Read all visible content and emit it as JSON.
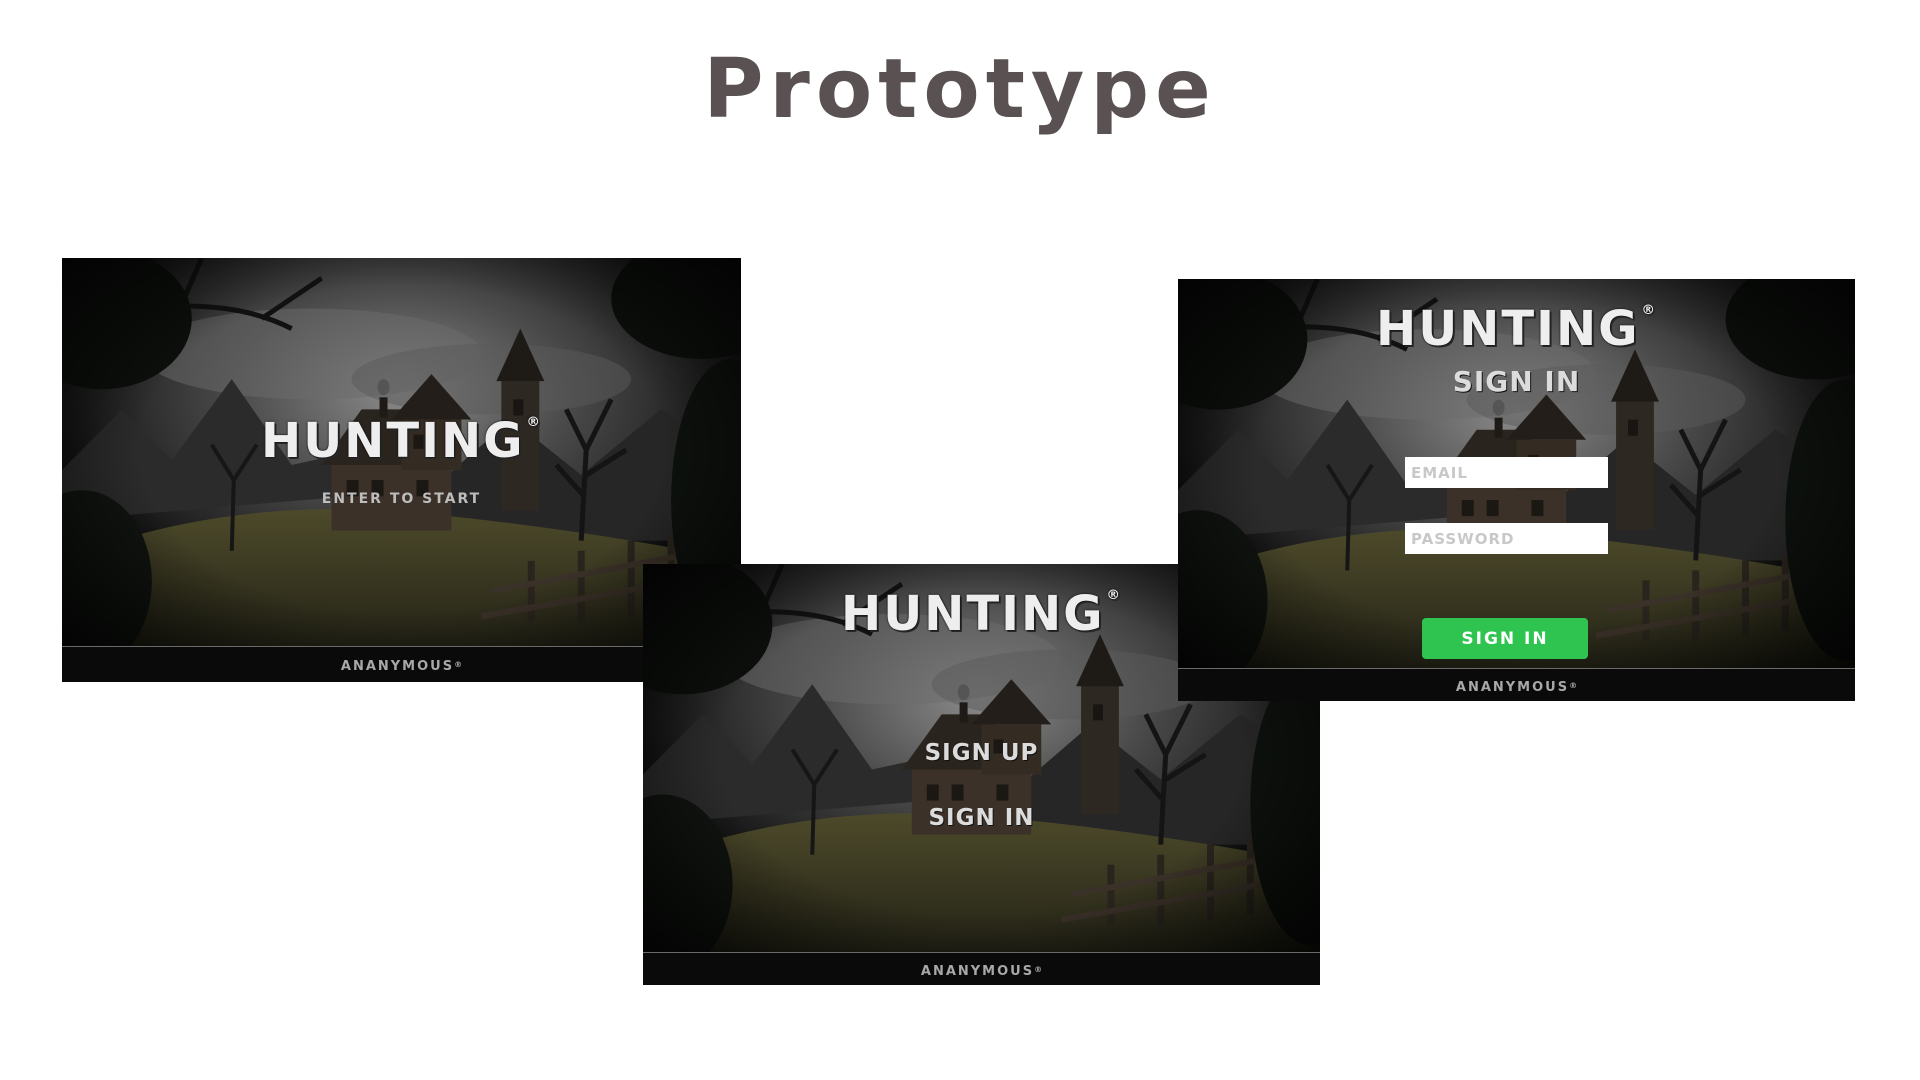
{
  "slide": {
    "title": "Prototype"
  },
  "brand": {
    "logo_text": "HUNTING",
    "registered_mark": "®",
    "footer_text": "ANANYMOUS",
    "accent_color": "#2fc44f"
  },
  "screen_start": {
    "prompt": "ENTER TO START"
  },
  "screen_menu": {
    "sign_up_label": "SIGN UP",
    "sign_in_label": "SIGN IN"
  },
  "screen_signin": {
    "heading": "SIGN IN",
    "email_placeholder": "EMAIL",
    "password_placeholder": "PASSWORD",
    "submit_label": "SIGN IN"
  }
}
